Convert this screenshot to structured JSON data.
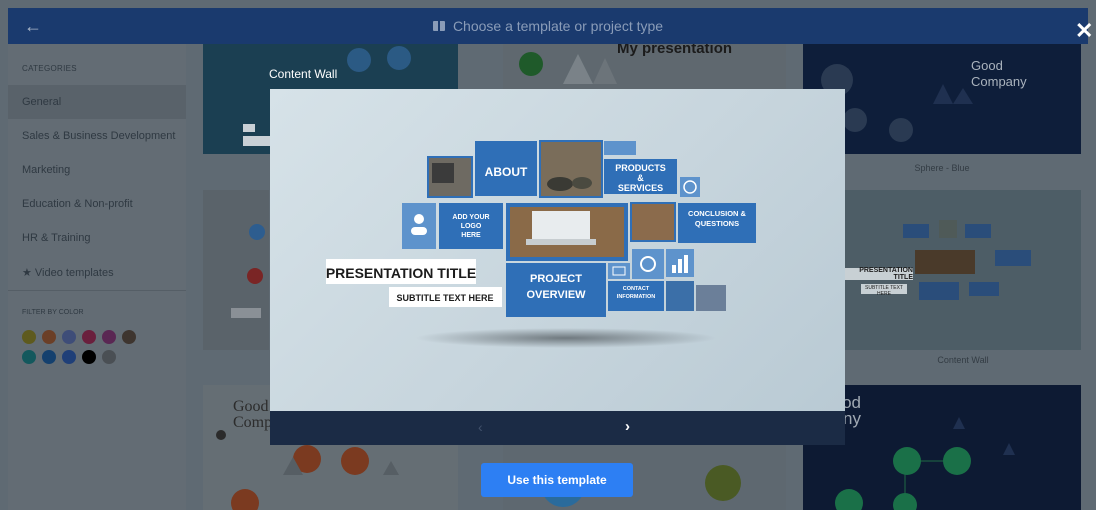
{
  "header": {
    "back_icon": "arrow-left-icon",
    "icon": "book-icon",
    "title": "Choose a template or project type",
    "close_label": "✕"
  },
  "sidebar": {
    "categories_heading": "CATEGORIES",
    "categories": [
      {
        "label": "General",
        "active": true
      },
      {
        "label": "Sales & Business Development",
        "active": false
      },
      {
        "label": "Marketing",
        "active": false
      },
      {
        "label": "Education & Non-profit",
        "active": false
      },
      {
        "label": "HR & Training",
        "active": false
      },
      {
        "label": "★ Video templates",
        "active": false
      }
    ],
    "filter_heading": "FILTER BY COLOR",
    "colors": [
      "#5e5a1e",
      "#6b3f27",
      "#3e4d78",
      "#6a1f3d",
      "#5a2753",
      "#3e352f",
      "#13585d",
      "#14406e",
      "#1f3f78",
      "#000000",
      "#4a4f54"
    ]
  },
  "background_cards": {
    "card_my_presentation_title": "My presentation",
    "card_good_company_title": "Good Company",
    "card_sphere_label": "Sphere - Blue",
    "card_content_wall_label": "Content Wall",
    "card_bottom_left_title": "Good Company",
    "card_bottom_right_title": "Good company",
    "card_content_wall_small_title": "PRESENTATION TITLE",
    "card_content_wall_small_subtitle": "SUBTITLE TEXT HERE"
  },
  "modal": {
    "template_name": "Content Wall",
    "preview": {
      "about": "ABOUT",
      "products": "PRODUCTS & SERVICES",
      "logo": "ADD YOUR LOGO HERE",
      "conclusion": "CONCLUSION & QUESTIONS",
      "title": "PRESENTATION TITLE",
      "subtitle": "SUBTITLE TEXT HERE",
      "project": "PROJECT OVERVIEW",
      "contact": "CONTACT INFORMATION"
    },
    "prev_label": "‹",
    "next_label": "›",
    "use_button": "Use this template"
  }
}
